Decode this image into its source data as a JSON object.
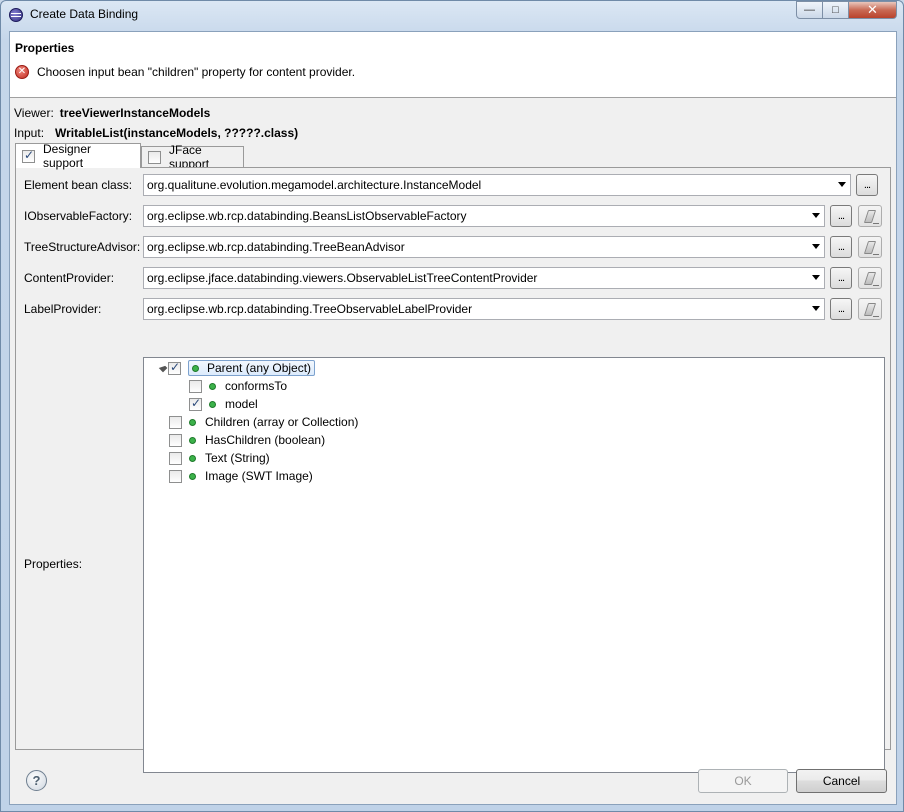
{
  "window": {
    "title": "Create Data Binding",
    "minimize_glyph": "—",
    "maximize_glyph": "□",
    "close_glyph": "✕"
  },
  "header": {
    "title": "Properties",
    "error_icon": "error-x-icon",
    "message": "Choosen input bean \"children\" property for content provider."
  },
  "info": {
    "viewer_label": "Viewer:",
    "viewer_value": "treeViewerInstanceModels",
    "input_label": "Input:",
    "input_value": "WritableList(instanceModels, ?????.class)"
  },
  "tabs": [
    {
      "label": "Designer support",
      "checked": true,
      "active": true
    },
    {
      "label": "JFace support",
      "checked": false,
      "active": false
    }
  ],
  "fields": [
    {
      "label": "Element bean class:",
      "value": "org.qualitune.evolution.megamodel.architecture.InstanceModel",
      "browse": "...",
      "clear": false
    },
    {
      "label": "IObservableFactory:",
      "value": "org.eclipse.wb.rcp.databinding.BeansListObservableFactory",
      "browse": "...",
      "clear": true
    },
    {
      "label": "TreeStructureAdvisor:",
      "value": "org.eclipse.wb.rcp.databinding.TreeBeanAdvisor",
      "browse": "...",
      "clear": true
    },
    {
      "label": "ContentProvider:",
      "value": "org.eclipse.jface.databinding.viewers.ObservableListTreeContentProvider",
      "browse": "...",
      "clear": true
    },
    {
      "label": "LabelProvider:",
      "value": "org.eclipse.wb.rcp.databinding.TreeObservableLabelProvider",
      "browse": "...",
      "clear": true
    }
  ],
  "properties_label": "Properties:",
  "tree": [
    {
      "label": "Parent (any Object)",
      "checked": true,
      "level": 0,
      "expanded": true,
      "selected": true
    },
    {
      "label": "conformsTo",
      "checked": false,
      "level": 1
    },
    {
      "label": "model",
      "checked": true,
      "level": 1
    },
    {
      "label": "Children (array or Collection)",
      "checked": false,
      "level": 0
    },
    {
      "label": "HasChildren (boolean)",
      "checked": false,
      "level": 0
    },
    {
      "label": "Text (String)",
      "checked": false,
      "level": 0
    },
    {
      "label": "Image (SWT Image)",
      "checked": false,
      "level": 0
    }
  ],
  "footer": {
    "help_glyph": "?",
    "ok_label": "OK",
    "ok_enabled": false,
    "cancel_label": "Cancel"
  }
}
